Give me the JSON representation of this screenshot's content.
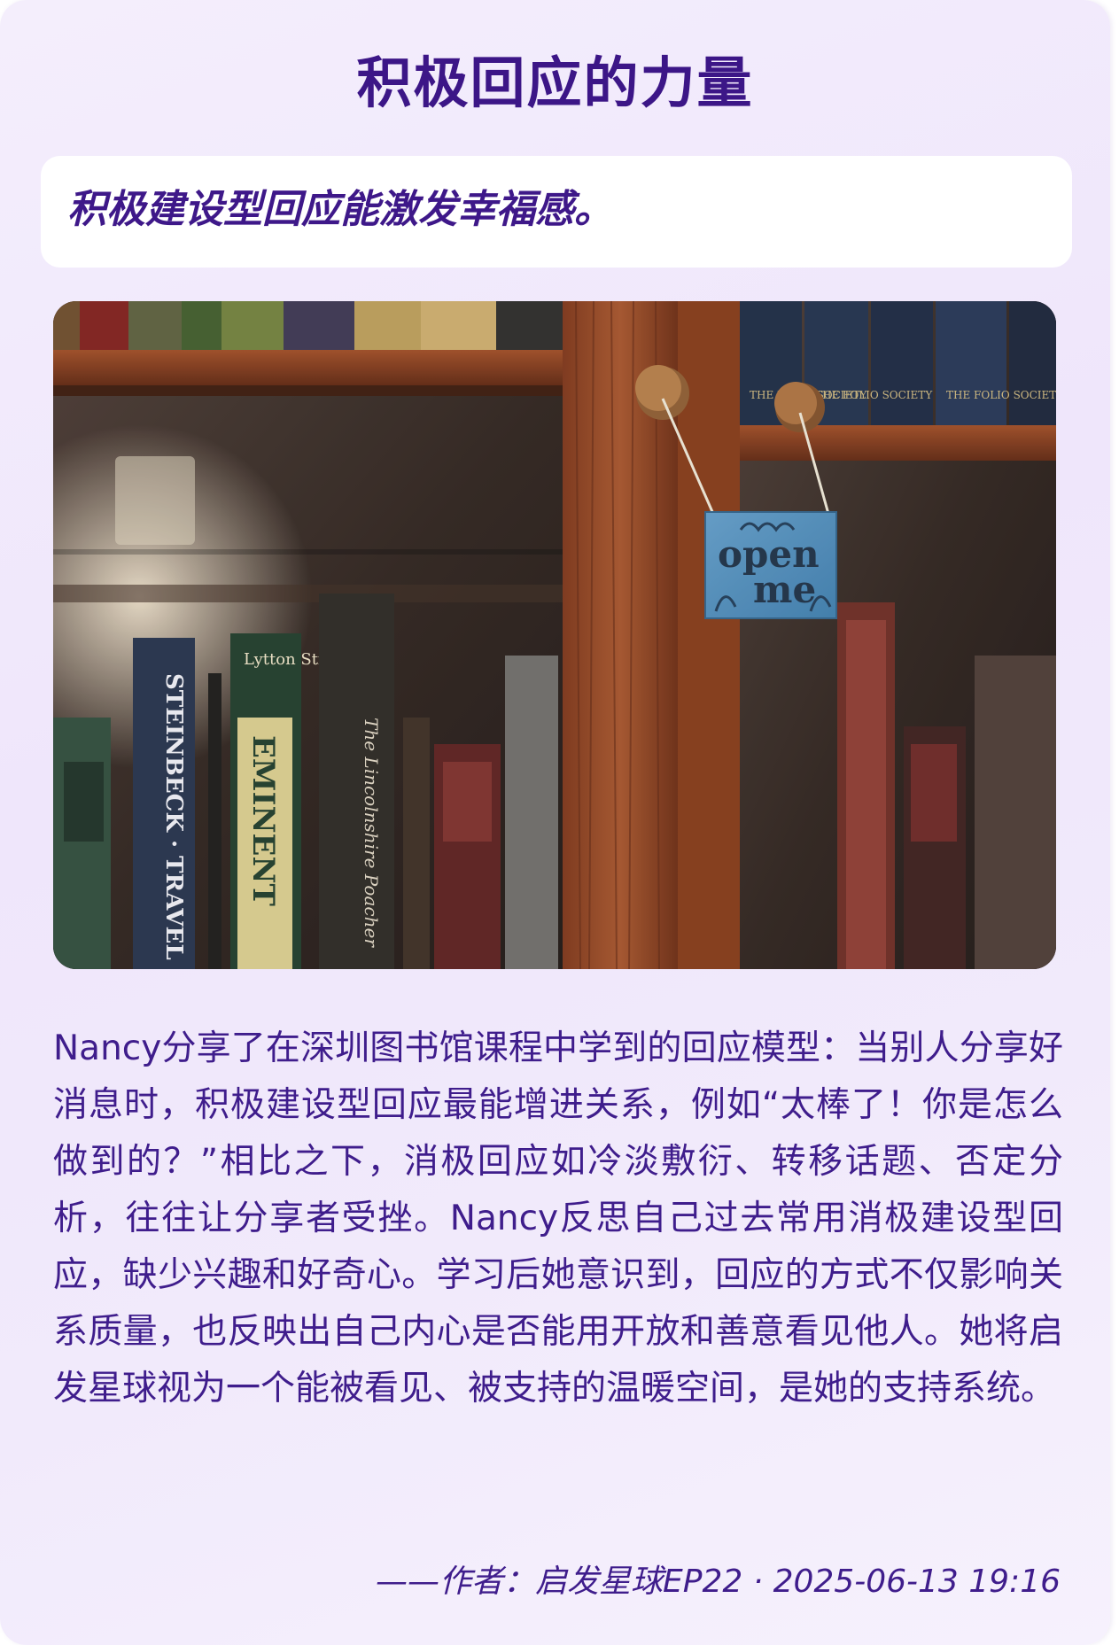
{
  "title": "积极回应的力量",
  "subtitle": "积极建设型回应能激发幸福感。",
  "photo": {
    "sign_line1": "open",
    "sign_line2": "me",
    "spines": {
      "steinbeck": "STEINBECK · TRAVEL",
      "lytton": "Lytton Strachey",
      "eminent": "EMINENT",
      "poacher": "The Lincolnshire Poacher",
      "society1": "THE FOLIO SOCIETY",
      "society2": "THE FOLIO SOCIETY",
      "society3": "THE FOLIO SOCIETY"
    }
  },
  "body": "Nancy分享了在深圳图书馆课程中学到的回应模型：当别人分享好消息时，积极建设型回应最能增进关系，例如“太棒了！你是怎么做到的？”相比之下，消极回应如冷淡敷衍、转移话题、否定分析，往往让分享者受挫。Nancy反思自己过去常用消极建设型回应，缺少兴趣和好奇心。学习后她意识到，回应的方式不仅影响关系质量，也反映出自己内心是否能用开放和善意看见他人。她将启发星球视为一个能被看见、被支持的温暖空间，是她的支持系统。",
  "footer": "——作者：启发星球EP22 · 2025-06-13 19:16"
}
